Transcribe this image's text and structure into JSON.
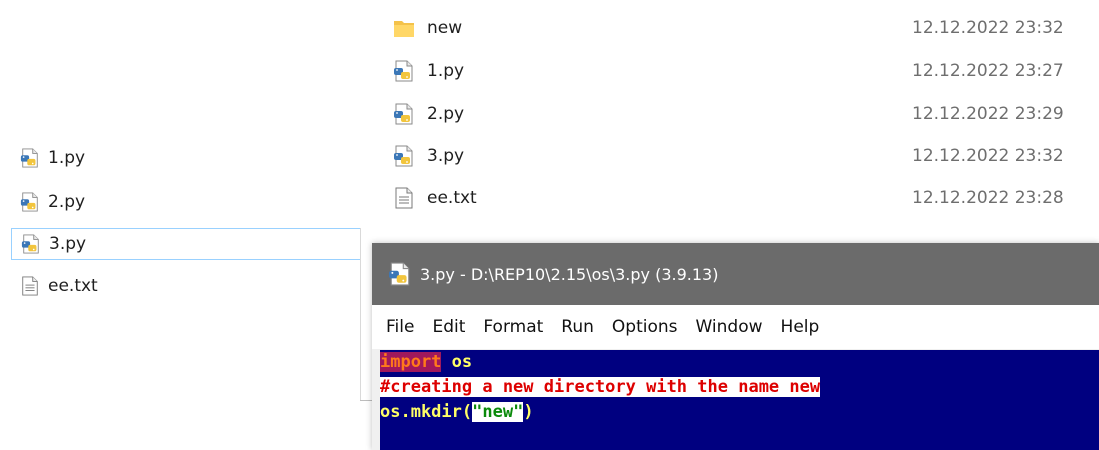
{
  "left_explorer": {
    "items": [
      {
        "name": "1.py",
        "icon": "python-file-icon",
        "selected": false
      },
      {
        "name": "2.py",
        "icon": "python-file-icon",
        "selected": false
      },
      {
        "name": "3.py",
        "icon": "python-file-icon",
        "selected": true
      },
      {
        "name": "ee.txt",
        "icon": "text-file-icon",
        "selected": false
      }
    ]
  },
  "right_explorer": {
    "items": [
      {
        "name": "new",
        "date": "12.12.2022 23:32",
        "icon": "folder-icon"
      },
      {
        "name": "1.py",
        "date": "12.12.2022 23:27",
        "icon": "python-file-icon"
      },
      {
        "name": "2.py",
        "date": "12.12.2022 23:29",
        "icon": "python-file-icon"
      },
      {
        "name": "3.py",
        "date": "12.12.2022 23:32",
        "icon": "python-file-icon"
      },
      {
        "name": "ee.txt",
        "date": "12.12.2022 23:28",
        "icon": "text-file-icon"
      }
    ]
  },
  "idle_window": {
    "title": "3.py - D:\\REP10\\2.15\\os\\3.py (3.9.13)",
    "title_icon": "python-file-icon",
    "menu": [
      "File",
      "Edit",
      "Format",
      "Run",
      "Options",
      "Window",
      "Help"
    ],
    "code": {
      "line1_keyword": "import",
      "line1_module": " os",
      "line2_comment": "#creating a new directory with the name new",
      "line3_call": "os.mkdir(",
      "line3_string": "\"new\"",
      "line3_close": ")"
    }
  },
  "colors": {
    "editor_bg": "#000080",
    "keyword": "#ff7a1a",
    "comment": "#dd0000",
    "string": "#0a8a0a",
    "titlebar": "#6b6b6b",
    "selection_border": "#99d1ff"
  }
}
